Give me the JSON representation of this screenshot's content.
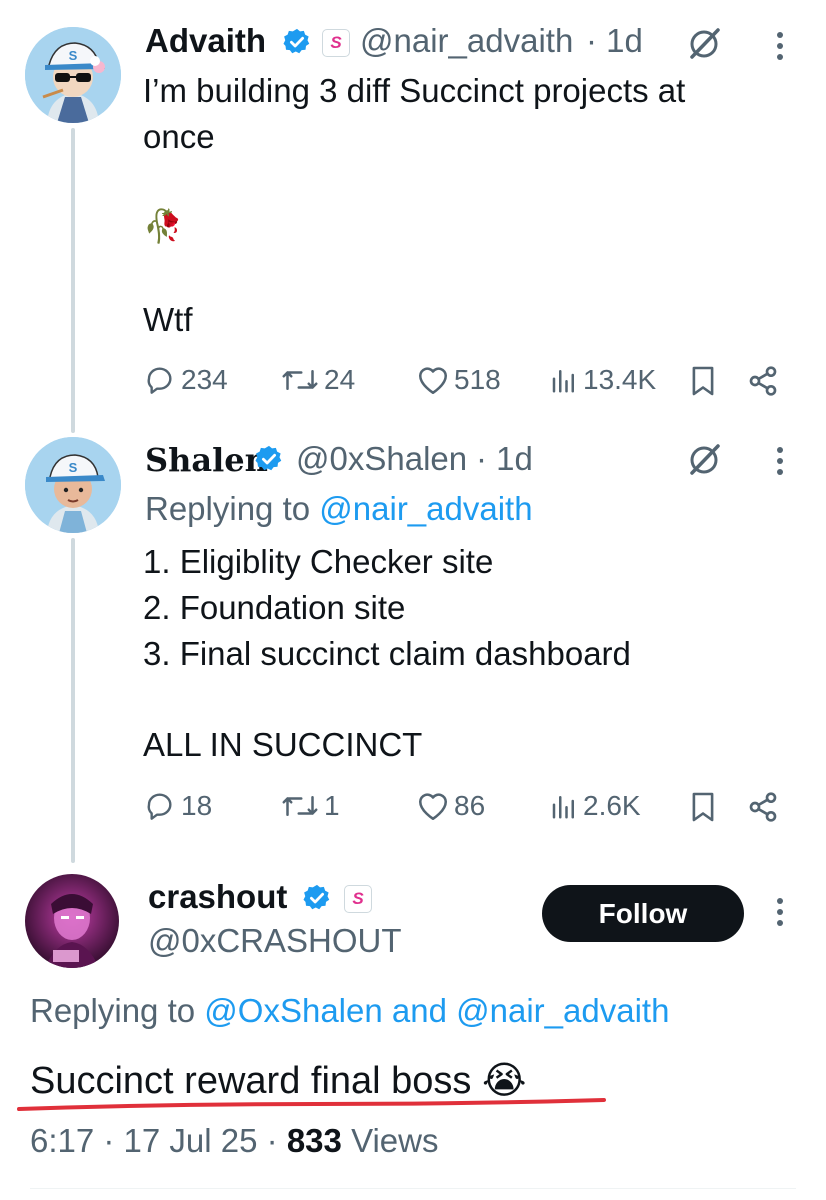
{
  "tweet1": {
    "name": "Advaith",
    "handle": "@nair_advaith",
    "time": "· 1d",
    "text_line1": "I’m building 3 diff Succinct projects at",
    "text_line2": "once",
    "emoji": "🥀",
    "text_line3": "Wtf",
    "replies": "234",
    "reposts": "24",
    "likes": "518",
    "views": "13.4K"
  },
  "tweet2": {
    "name": "Shalen",
    "handle": "@0xShalen",
    "time": "· 1d",
    "replying_prefix": "Replying to",
    "replying_to": "@nair_advaith",
    "line1": "1. Eligiblity Checker site",
    "line2": "2. Foundation site",
    "line3": "3. Final succinct claim dashboard",
    "line4": "ALL IN SUCCINCT",
    "replies": "18",
    "reposts": "1",
    "likes": "86",
    "views": "2.6K"
  },
  "tweet3": {
    "name": "crashout",
    "handle": "@0xCRASHOUT",
    "follow_label": "Follow",
    "replying_prefix": "Replying to",
    "replying_to_1": "@OxShalen",
    "replying_and": "and",
    "replying_to_2": "@nair_advaith",
    "text": "Succinct reward final boss",
    "emoji": "😭",
    "time": "6:17 · 17 Jul 25 ·",
    "views_count": "833",
    "views_label": "Views"
  },
  "colors": {
    "verified": "#1d9bf0",
    "link": "#1d9bf0",
    "muted": "#536471",
    "underline": "#e0303a",
    "follow_bg": "#0f1419"
  },
  "icons": [
    "verified-badge-icon",
    "succinct-badge-icon",
    "grok-icon",
    "more-icon",
    "reply-icon",
    "repost-icon",
    "like-icon",
    "views-icon",
    "bookmark-icon",
    "share-icon"
  ]
}
